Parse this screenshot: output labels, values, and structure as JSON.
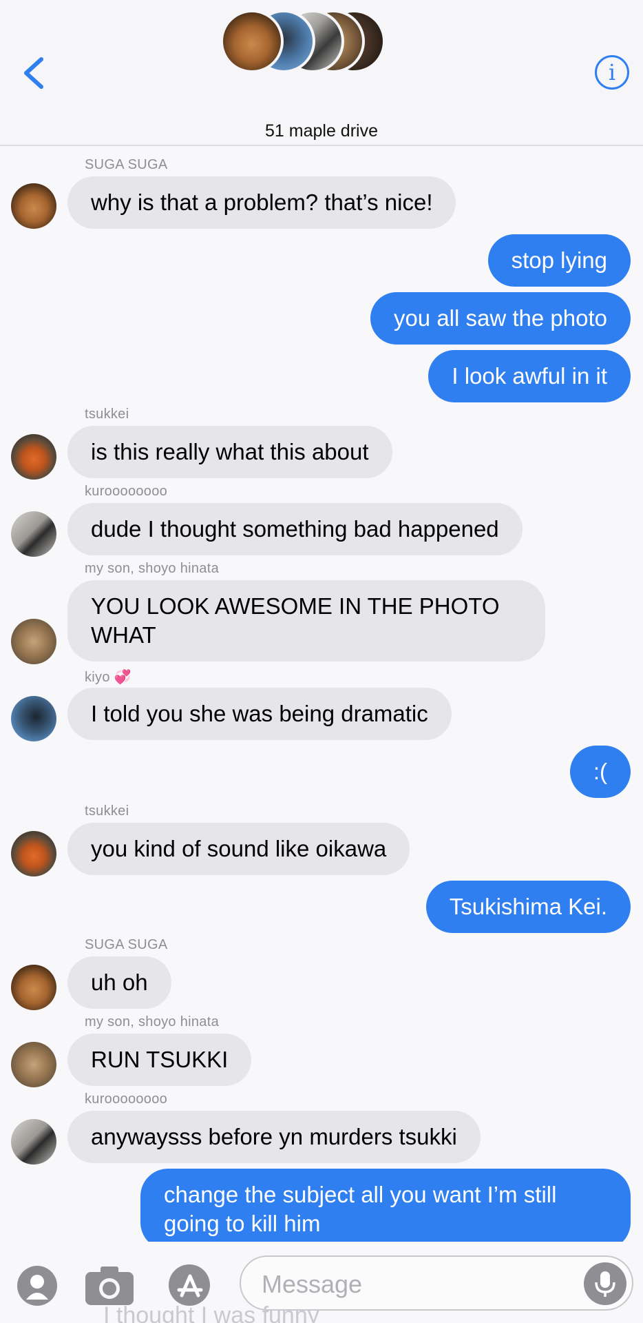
{
  "header": {
    "group_name": "51 maple drive",
    "back_icon": "chevron-left-icon",
    "info_icon": "info-icon"
  },
  "colors": {
    "accent": "#2f7ff0",
    "incoming_bubble": "#e6e5ea",
    "outgoing_text": "#ffffff",
    "sender_label": "#8e8e93"
  },
  "messages": [
    {
      "sender": "SUGA SUGA",
      "text": "why is that a problem? that’s nice!"
    },
    {
      "text": "stop lying"
    },
    {
      "text": "you all saw the photo"
    },
    {
      "text": "I look awful in it"
    },
    {
      "sender": "tsukkei",
      "text": "is this really what this about"
    },
    {
      "sender": "kuroooooooo",
      "text": "dude I thought something bad happened"
    },
    {
      "sender": "my son, shoyo hinata",
      "text": "YOU LOOK AWESOME IN THE PHOTO WHAT"
    },
    {
      "sender": "kiyo",
      "sender_emoji": "💞",
      "text": "I told you she was being dramatic"
    },
    {
      "text": ":("
    },
    {
      "sender": "tsukkei",
      "text": "you kind of sound like oikawa"
    },
    {
      "text": "Tsukishima Kei."
    },
    {
      "sender": "SUGA SUGA",
      "text": "uh oh"
    },
    {
      "sender": "my son, shoyo hinata",
      "text": "RUN TSUKKI"
    },
    {
      "sender": "kuroooooooo",
      "text": "anywaysss before yn murders tsukki"
    },
    {
      "text": "change the subject all you want I’m still going to kill him"
    }
  ],
  "composer": {
    "placeholder": "Message",
    "ghost_text": "I thought I was funny",
    "icons": [
      "animoji-icon",
      "camera-icon",
      "app-store-icon",
      "mic-icon"
    ]
  }
}
